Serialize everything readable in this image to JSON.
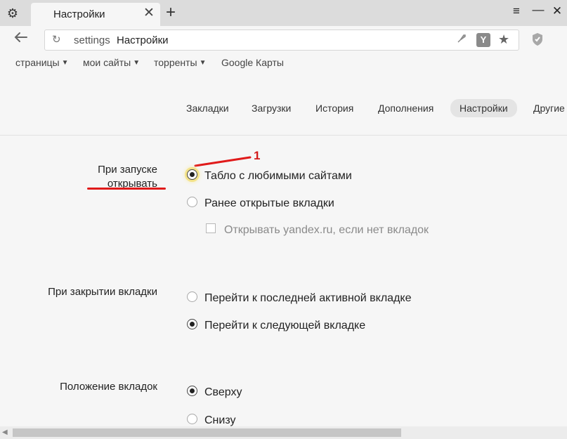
{
  "tab": {
    "title": "Настройки",
    "close": "✕"
  },
  "new_tab": "+",
  "window_controls": {
    "menu": "≡",
    "minimize": "—",
    "close": "✕"
  },
  "icons": {
    "settings": "gear-icon",
    "back": "back-arrow-icon",
    "reload": "reload-icon",
    "rocket": "rocket-icon",
    "protect": "yandex-protect-icon",
    "star": "star-icon",
    "shield": "shield-icon"
  },
  "omnibox": {
    "scheme": "settings",
    "title": "Настройки"
  },
  "bookmarks": [
    {
      "label": "страницы",
      "dropdown": true
    },
    {
      "label": "мои сайты",
      "dropdown": true
    },
    {
      "label": "торренты",
      "dropdown": true
    },
    {
      "label": "Google Карты",
      "dropdown": false
    }
  ],
  "nav": {
    "bookmarks": "Закладки",
    "downloads": "Загрузки",
    "history": "История",
    "addons": "Дополнения",
    "settings": "Настройки",
    "other": "Другие"
  },
  "startup": {
    "label_line1": "При запуске",
    "label_line2": "открывать",
    "options": [
      {
        "label": "Табло с любимыми сайтами",
        "checked": true
      },
      {
        "label": "Ранее открытые вкладки",
        "checked": false
      }
    ],
    "sub_option": {
      "label": "Открывать yandex.ru, если нет вкладок",
      "checked": false,
      "disabled": true
    }
  },
  "tab_close": {
    "label": "При закрытии вкладки",
    "options": [
      {
        "label": "Перейти к последней активной вкладке",
        "checked": false
      },
      {
        "label": "Перейти к следующей вкладке",
        "checked": true
      }
    ]
  },
  "tab_position": {
    "label": "Положение вкладок",
    "options": [
      {
        "label": "Сверху",
        "checked": true
      },
      {
        "label": "Снизу",
        "checked": false
      }
    ]
  },
  "annotation": {
    "number": "1",
    "color": "#e01a1a"
  }
}
